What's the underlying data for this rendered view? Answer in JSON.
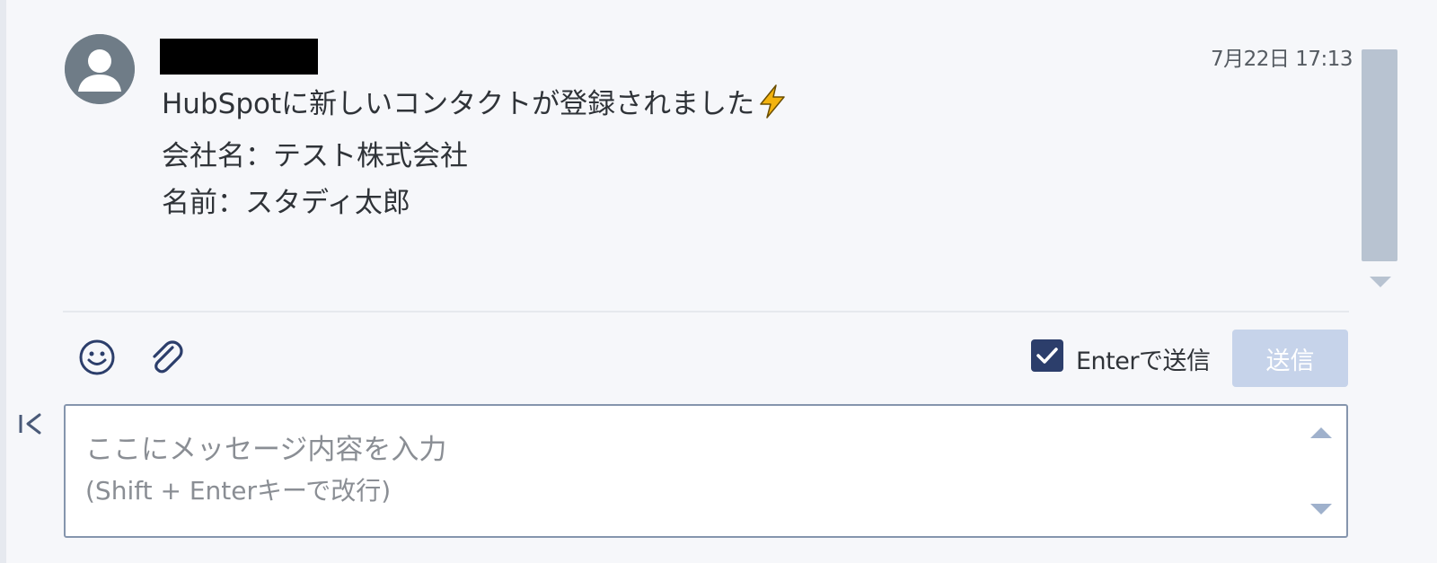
{
  "message": {
    "sender_name": "",
    "timestamp": "7月22日 17:13",
    "lines": [
      "HubSpotに新しいコンタクトが登録されました",
      "会社名：テスト株式会社",
      "名前：スタディ太郎"
    ],
    "title_emoji_icon": "lightning-bolt-icon"
  },
  "toolbar": {
    "emoji_icon": "smiley-face-icon",
    "attach_icon": "paperclip-icon",
    "enter_to_send_label": "Enterで送信",
    "enter_to_send_checked": true,
    "send_label": "送信"
  },
  "input": {
    "placeholder_line1": "ここにメッセージ内容を入力",
    "placeholder_line2": "(Shift + Enterキーで改行)",
    "value": ""
  },
  "sidebar": {
    "collapse_icon": "collapse-left-icon"
  },
  "colors": {
    "background": "#f6f7fa",
    "accent_dark": "#2c3e6b",
    "send_button_disabled": "#c6d3ea",
    "scrollbar": "#b8c3d1",
    "bolt": "#f3b30f"
  }
}
